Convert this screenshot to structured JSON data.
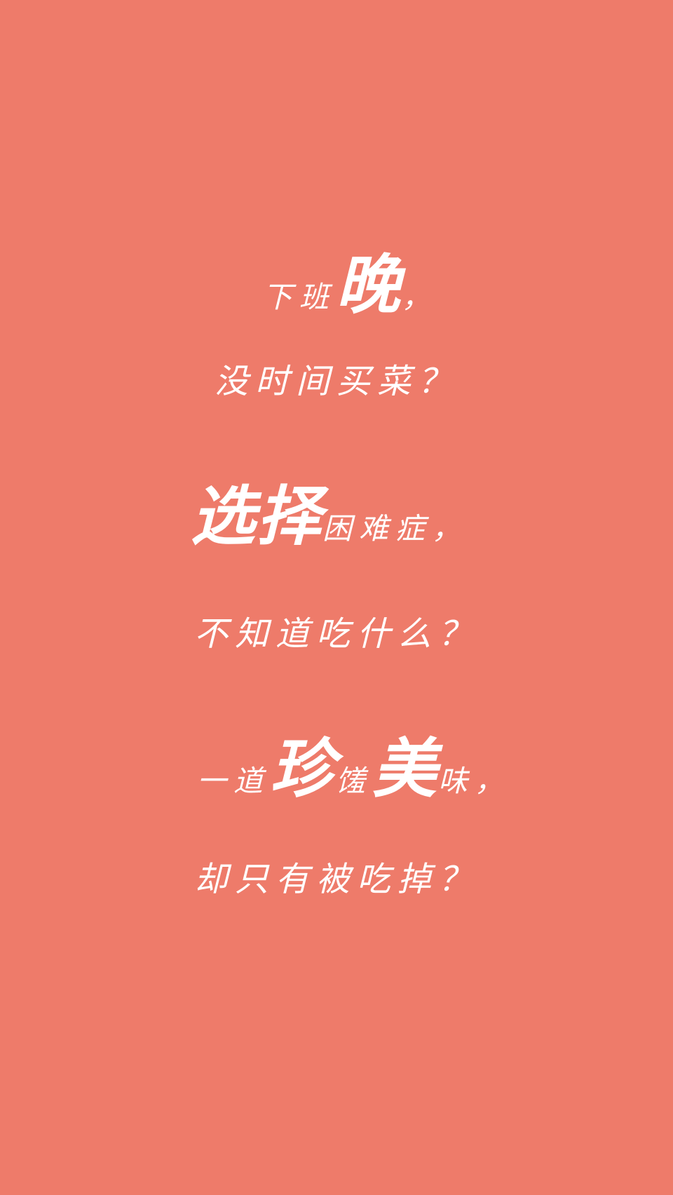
{
  "colors": {
    "background": "#EE7B6A",
    "text": "#FFFFFF"
  },
  "stanza1": {
    "line1_prefix": "下班",
    "line1_emph": "晚",
    "line1_suffix": "，",
    "line2": "没时间买菜？"
  },
  "stanza2": {
    "line1_emph": "选择",
    "line1_rest": "困难症，",
    "line2": "不知道吃什么？"
  },
  "stanza3": {
    "line1_a": "一道",
    "line1_emph1": "珍",
    "line1_b": "馐",
    "line1_emph2": "美",
    "line1_c": "味，",
    "line2": "却只有被吃掉？"
  }
}
